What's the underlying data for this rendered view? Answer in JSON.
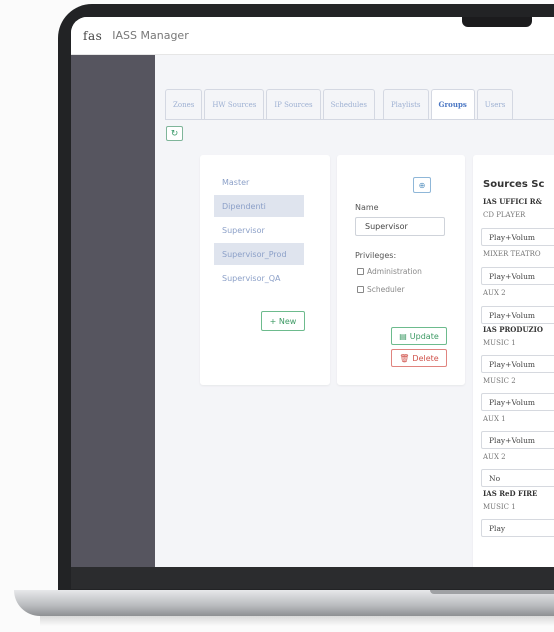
{
  "app": {
    "logo": "fas",
    "title": "IASS Manager"
  },
  "tabs": [
    "Zones",
    "HW Sources",
    "IP Sources",
    "Schedules",
    "Playlists",
    "Groups",
    "Users"
  ],
  "active_tab": "Groups",
  "groups": [
    "Master",
    "Dipendenti",
    "Supervisor",
    "Supervisor_Prod",
    "Supervisor_QA"
  ],
  "selected_groups": [
    "Dipendenti",
    "Supervisor_Prod"
  ],
  "new_button": "+ New",
  "detail": {
    "name_label": "Name",
    "name_value": "Supervisor",
    "privileges_label": "Privileges:",
    "privileges": [
      "Administration",
      "Scheduler"
    ],
    "update_button": "Update",
    "delete_button": "Delete"
  },
  "sources": {
    "title": "Sources Sc",
    "sections": [
      {
        "group": "IAS UFFICI R&",
        "items": [
          {
            "name": "CD PLAYER",
            "value": "Play+Volum"
          },
          {
            "name": "MIXER TEATRO",
            "value": "Play+Volum"
          },
          {
            "name": "AUX 2",
            "value": "Play+Volum"
          }
        ]
      },
      {
        "group": "IAS PRODUZIO",
        "items": [
          {
            "name": "MUSIC 1",
            "value": "Play+Volum"
          },
          {
            "name": "MUSIC 2",
            "value": "Play+Volum"
          },
          {
            "name": "AUX 1",
            "value": "Play+Volum"
          },
          {
            "name": "AUX 2",
            "value": "No"
          }
        ]
      },
      {
        "group": "IAS ReD FIRE",
        "items": [
          {
            "name": "MUSIC 1",
            "value": "Play"
          }
        ]
      }
    ]
  },
  "colors": {
    "accent": "#4a76c3",
    "success": "#3d9a64",
    "danger": "#d0524b",
    "desk": "#56555f"
  }
}
